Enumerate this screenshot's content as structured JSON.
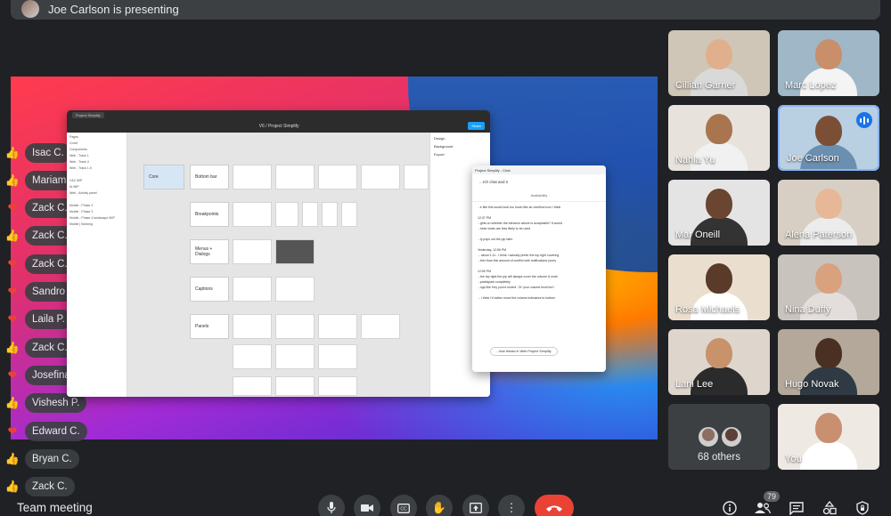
{
  "presenter": {
    "text": "Joe Carlson is presenting"
  },
  "shared_screen": {
    "figma": {
      "tab": "Project Simplify",
      "title": "V6 / Project Simplify",
      "share_label": "Share",
      "layers": [
        "Pages",
        "Cover",
        "Components",
        "Web - Track 1",
        "Web - Track 4",
        "Web - Track 1.5",
        "",
        "V&Z WIP",
        "IA WIP",
        "Web - Activity panel",
        "",
        "Mobile - Phase 2",
        "Mobile - Phase 3",
        "Mobile - Phase 4 landscape WIP",
        "Mobile | Working"
      ],
      "properties": [
        "Design",
        "Background",
        "Export"
      ],
      "frames": [
        "Core",
        "Bottom bar",
        "Breakpoints",
        "Menus + Dialogs",
        "Captions",
        "Panels"
      ]
    },
    "chat": {
      "header": "Project Simplify - Chat",
      "search": "...rch chat and n",
      "tab": "Availability",
      "lines": [
        "...e like this would look too much like an overflow icon I think",
        "",
        "12:37 PM",
        "...ghts on whether the behavior above is acceptable? It would",
        "...hese chats are less likely to be used",
        "",
        "...ly pops out the pip later.",
        "",
        "Yesterday, 12:56 PM",
        "... about 1.1x - I think I actually prefer the top right covering",
        "...ther than this amount of conflict with notifications (sorry",
        "",
        "12:59 PM",
        "...the top right the pip will always cover the volume & mute",
        "...participant completely",
        "...ngs like 'hey you're muted'. Or 'your volume level isn't",
        "",
        "... I think I'd rather move the volume indicators to bottom"
      ],
      "reply": "...llow thread in Web Project Simplify"
    }
  },
  "reactions": [
    {
      "icon": "thumbs-up-icon",
      "kind": "thumb",
      "name": "Isac C."
    },
    {
      "icon": "thumbs-up-icon",
      "kind": "thumb",
      "name": "Mariam C."
    },
    {
      "icon": "heart-icon",
      "kind": "heart",
      "name": "Zack C."
    },
    {
      "icon": "thumbs-up-icon",
      "kind": "thumb",
      "name": "Zack C."
    },
    {
      "icon": "heart-icon",
      "kind": "heart",
      "name": "Zack C."
    },
    {
      "icon": "heart-icon",
      "kind": "heart",
      "name": "Sandro C."
    },
    {
      "icon": "heart-icon",
      "kind": "heart",
      "name": "Laila P."
    },
    {
      "icon": "thumbs-up-icon",
      "kind": "thumb",
      "name": "Zack C."
    },
    {
      "icon": "heart-icon",
      "kind": "heart",
      "name": "Josefina-Karin C."
    },
    {
      "icon": "thumbs-up-icon",
      "kind": "thumb",
      "name": "Vishesh P."
    },
    {
      "icon": "heart-icon",
      "kind": "heart",
      "name": "Edward C."
    },
    {
      "icon": "thumbs-up-icon",
      "kind": "thumb",
      "name": "Bryan C."
    },
    {
      "icon": "thumbs-up-icon",
      "kind": "thumb",
      "name": "Zack C."
    }
  ],
  "participants": [
    {
      "name": "Cillian Garner",
      "bg": "#cfc6b8",
      "skin": "#e0b08c",
      "shirt": "#d9d9d9"
    },
    {
      "name": "Marc Lopez",
      "bg": "#9fb7c7",
      "skin": "#c98f6a",
      "shirt": "#f4f4f4"
    },
    {
      "name": "Nahla Yu",
      "bg": "#e7e3dc",
      "skin": "#a8754f",
      "shirt": "#f1f1f1"
    },
    {
      "name": "Joe Carlson",
      "bg": "#b9cfe2",
      "skin": "#7b4f36",
      "shirt": "#6b8fb0"
    },
    {
      "name": "Mar Oneill",
      "bg": "#e4e4e4",
      "skin": "#6a4530",
      "shirt": "#333333"
    },
    {
      "name": "Alena Paterson",
      "bg": "#d8cfc4",
      "skin": "#e6b898",
      "shirt": "#ececec"
    },
    {
      "name": "Rosa Michaels",
      "bg": "#eadfce",
      "skin": "#5a3a28",
      "shirt": "#ffffff"
    },
    {
      "name": "Nina Duffy",
      "bg": "#c9c3bd",
      "skin": "#d9a27e",
      "shirt": "#e3dedb"
    },
    {
      "name": "Lani Lee",
      "bg": "#ded6cd",
      "skin": "#c8926b",
      "shirt": "#2b2b2b"
    },
    {
      "name": "Hugo Novak",
      "bg": "#b3a89a",
      "skin": "#4a3022",
      "shirt": "#2f3a44"
    },
    {
      "name": "68 others",
      "bg": "#3c4043",
      "skin": "",
      "shirt": ""
    },
    {
      "name": "You",
      "bg": "#efe9e3",
      "skin": "#c89070",
      "shirt": "#ffffff"
    }
  ],
  "meeting": {
    "name": "Team meeting",
    "participant_count": "79"
  },
  "colors": {
    "background": "#202124",
    "surface": "#3c4043",
    "end_call": "#ea4335",
    "accent": "#1a73e8"
  }
}
